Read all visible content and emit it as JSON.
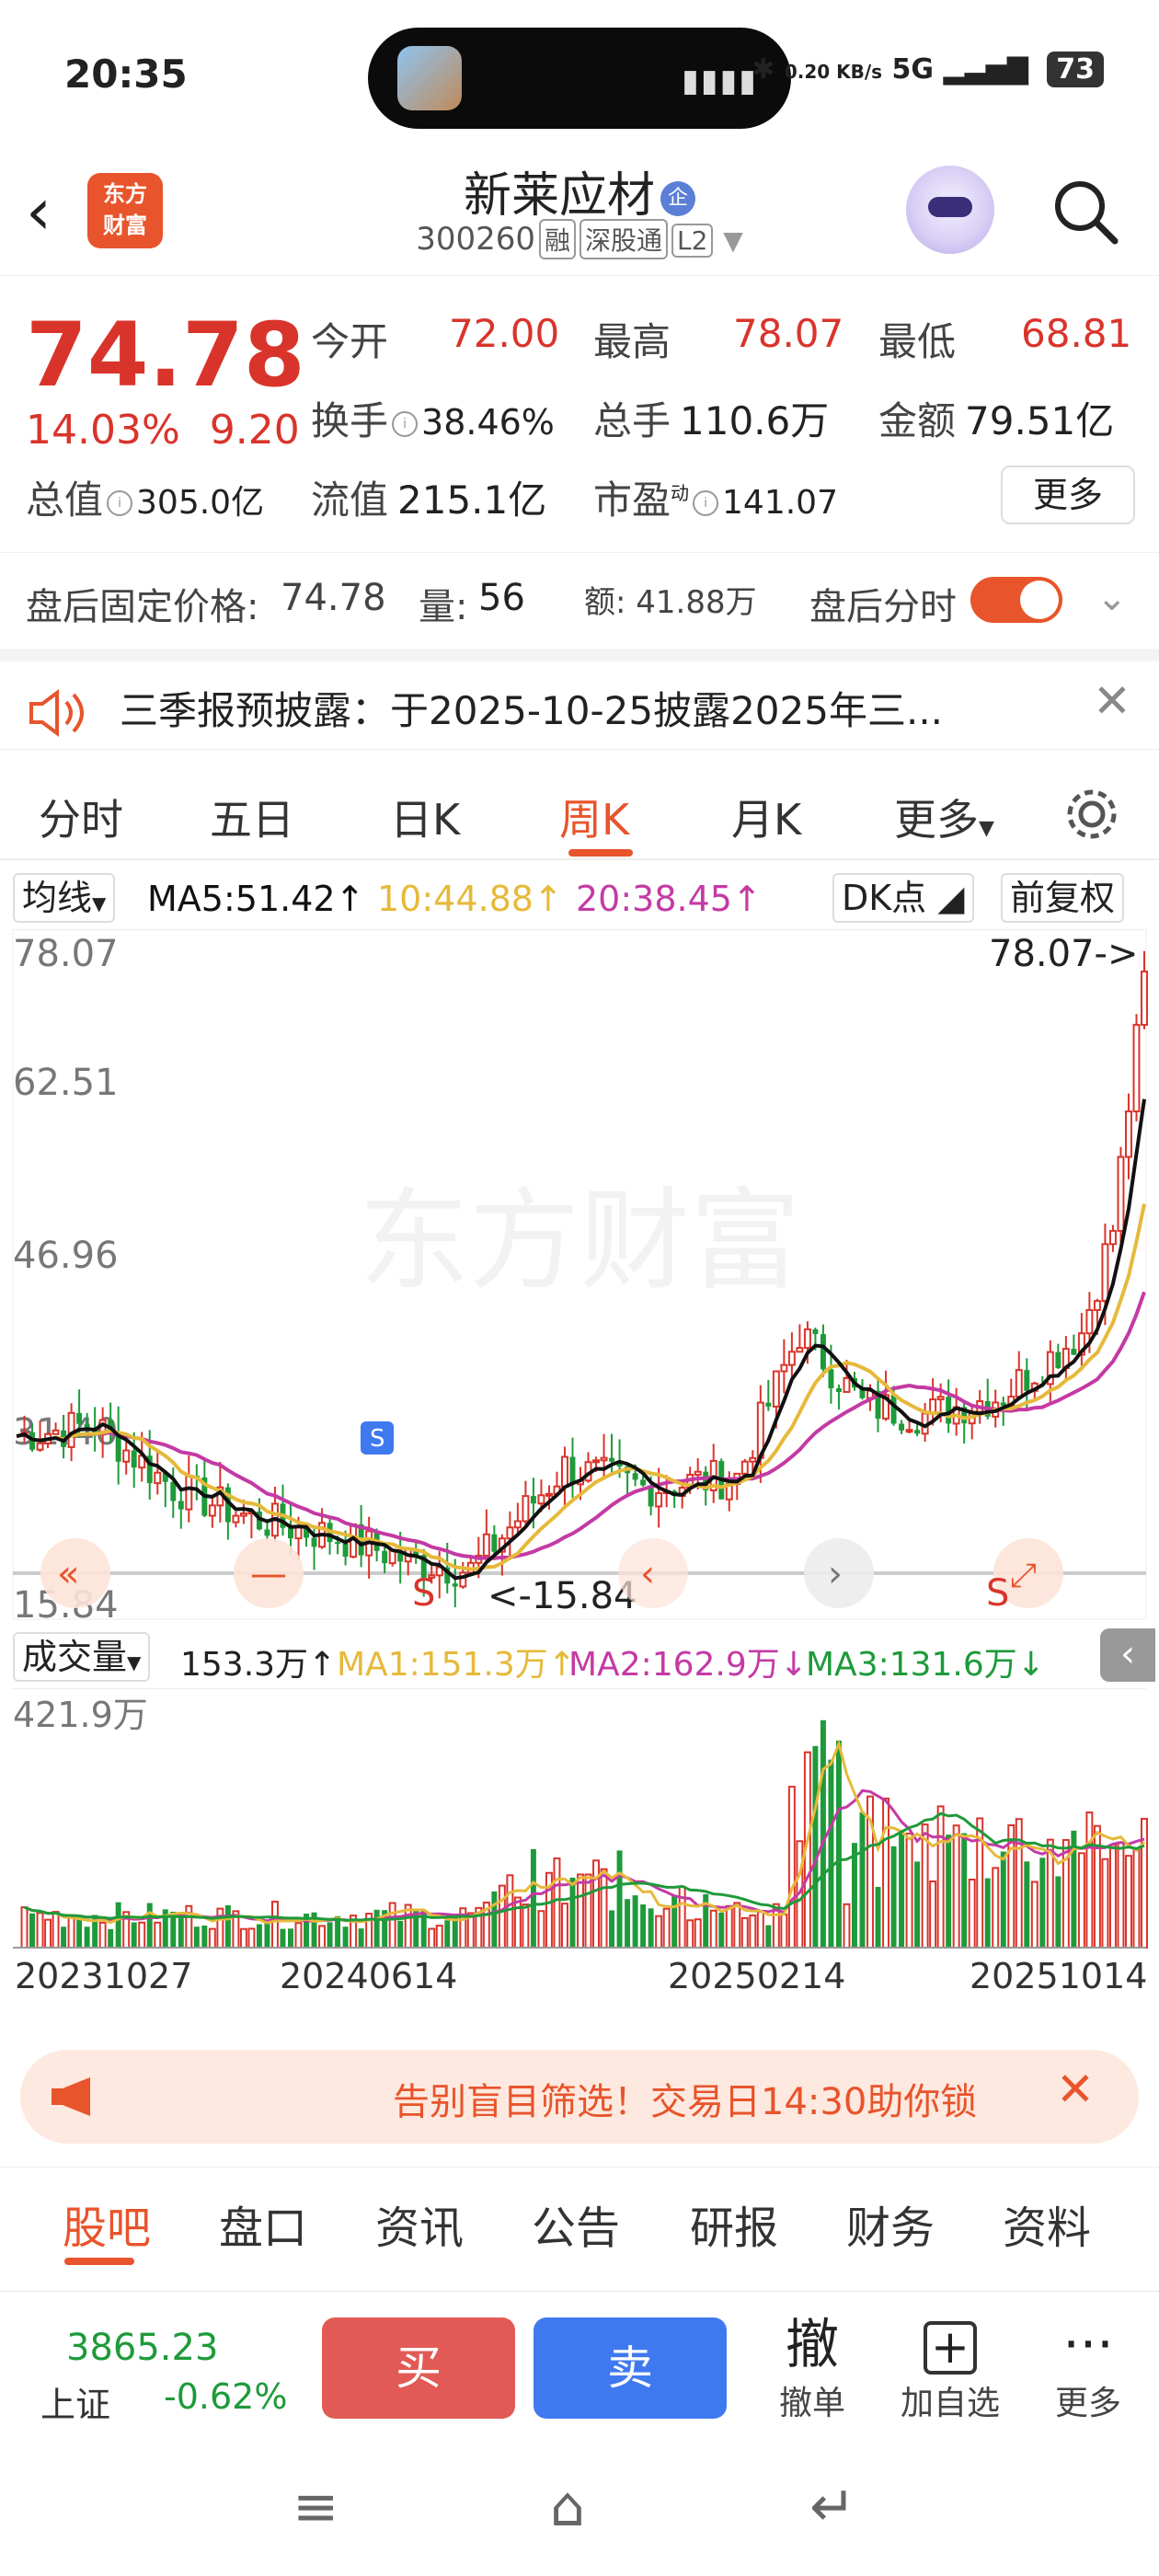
{
  "status": {
    "time": "20:35",
    "net": "0.20 KB/s",
    "signal": "5G",
    "battery": "73"
  },
  "header": {
    "name": "新莱应材",
    "qi": "企",
    "code": "300260",
    "tags": [
      "融",
      "深股通",
      "L2"
    ]
  },
  "quote": {
    "price": "74.78",
    "pct": "14.03%",
    "chg": "9.20",
    "open_k": "今开",
    "open_v": "72.00",
    "high_k": "最高",
    "high_v": "78.07",
    "low_k": "最低",
    "low_v": "68.81",
    "turnover_k": "换手",
    "turnover_v": "38.46%",
    "vol_k": "总手",
    "vol_v": "110.6万",
    "amount_k": "金额",
    "amount_v": "79.51亿",
    "mcap_k": "总值",
    "mcap_v": "305.0亿",
    "float_k": "流值",
    "float_v": "215.1亿",
    "pe_k": "市盈",
    "pe_sup": "动",
    "pe_v": "141.07",
    "more": "更多"
  },
  "after": {
    "price_k": "盘后固定价格:",
    "price_v": "74.78",
    "vol_k": "量:",
    "vol_v": "56",
    "amt_k": "额:",
    "amt_v": "41.88万",
    "toggle_label": "盘后分时"
  },
  "notice": {
    "text": "三季报预披露：于2025-10-25披露2025年三..."
  },
  "tabs": [
    "分时",
    "五日",
    "日K",
    "周K",
    "月K",
    "更多"
  ],
  "ma": {
    "label": "均线",
    "ma5": "MA5:51.42",
    "ma10": "10:44.88",
    "ma20": "20:38.45",
    "dk": "DK点",
    "fq": "前复权"
  },
  "chart": {
    "y_labels": [
      "78.07",
      "62.51",
      "46.96",
      "31.40",
      "15.84"
    ],
    "max_label": "78.07->",
    "min_label": "<-15.84",
    "watermark": "东方财富",
    "markers": [
      "S",
      "S",
      "S"
    ]
  },
  "volume": {
    "label": "成交量",
    "value": "153.3万",
    "ma1": "MA1:151.3万",
    "ma2": "MA2:162.9万",
    "ma3": "MA3:131.6万",
    "max_label": "421.9万",
    "dates": [
      "20231027",
      "20240614",
      "20250214",
      "20251014"
    ]
  },
  "banner": {
    "text": "告别盲目筛选！交易日14:30助你锁"
  },
  "bottom_tabs": [
    "股吧",
    "盘口",
    "资讯",
    "公告",
    "研报",
    "财务",
    "资料"
  ],
  "trade": {
    "index_value": "3865.23",
    "index_name": "上证",
    "index_chg": "-0.62%",
    "buy": "买",
    "sell": "卖",
    "cancel_icon": "撤",
    "cancel": "撤单",
    "watch_icon": "+",
    "watch": "加自选",
    "more": "更多"
  },
  "colors": {
    "up": "#d9342b",
    "down": "#1e9a3a",
    "accent": "#e8542b",
    "ma5": "#111111",
    "ma10": "#e6b93a",
    "ma20": "#c43aa4"
  }
}
